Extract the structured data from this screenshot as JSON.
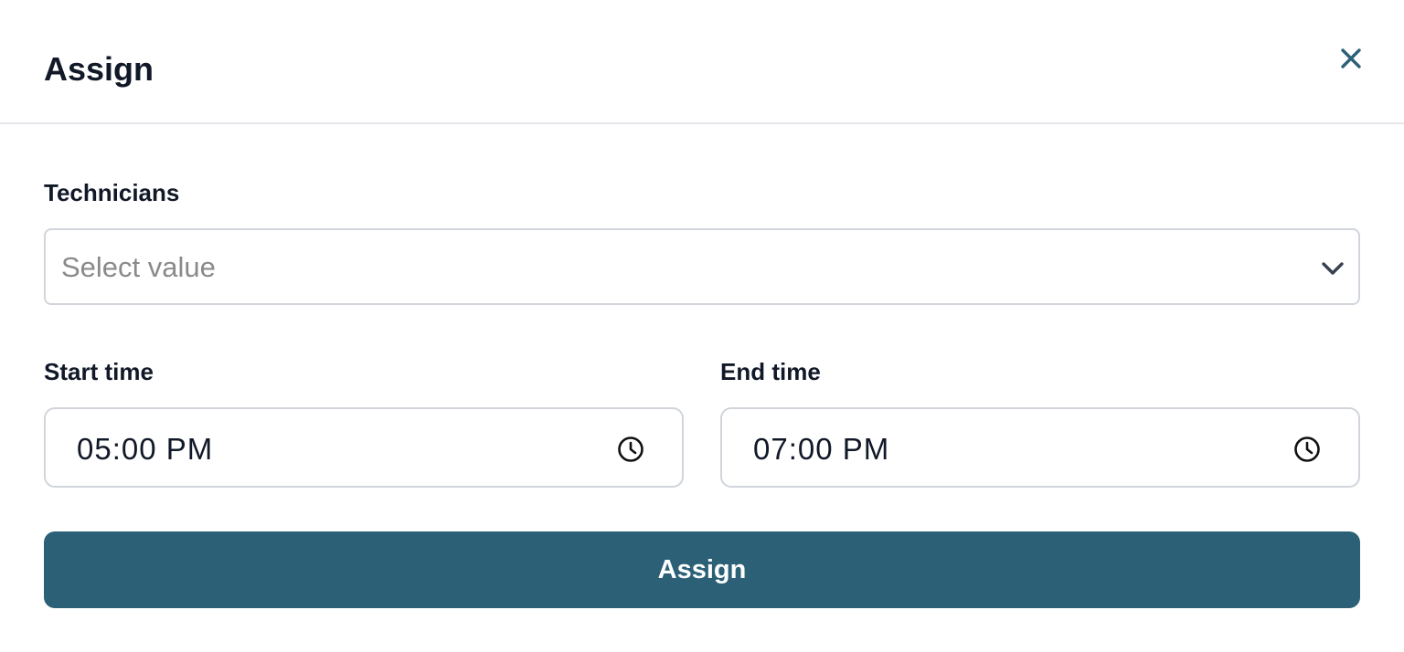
{
  "dialog": {
    "title": "Assign",
    "close_icon": "close-icon"
  },
  "technicians": {
    "label": "Technicians",
    "placeholder": "Select value",
    "dropdown_icon": "chevron-down-icon"
  },
  "start_time": {
    "label": "Start time",
    "value": "05:00 PM",
    "icon": "clock-icon"
  },
  "end_time": {
    "label": "End time",
    "value": "07:00 PM",
    "icon": "clock-icon"
  },
  "actions": {
    "assign_label": "Assign"
  },
  "colors": {
    "primary": "#2b6077",
    "close_icon": "#2b6077",
    "text": "#111827",
    "placeholder": "#8a8a8a",
    "border": "#d1d5db"
  }
}
